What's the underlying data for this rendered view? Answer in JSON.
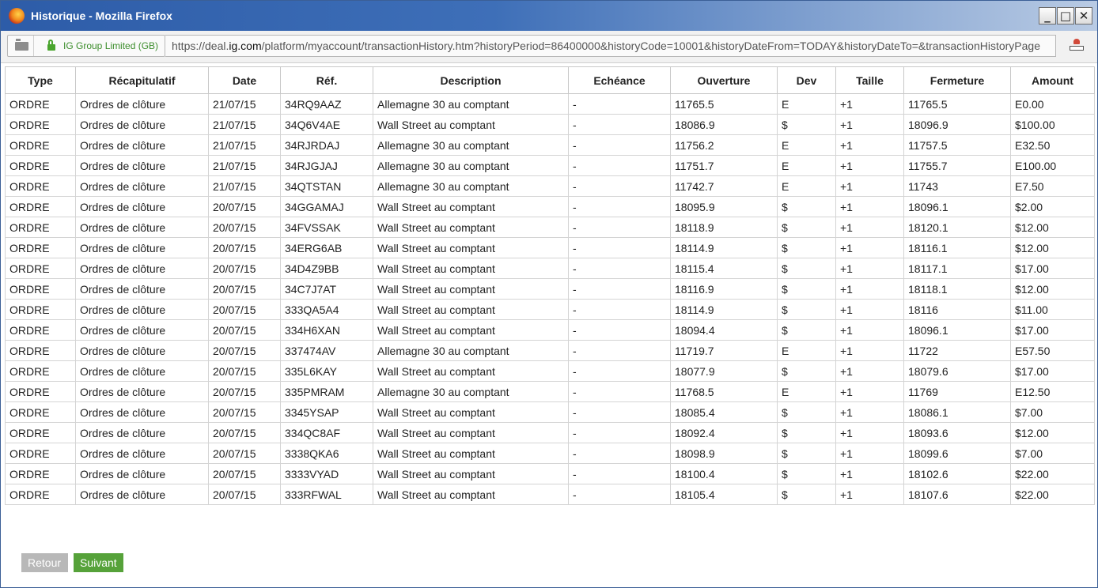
{
  "window": {
    "title": "Historique - Mozilla Firefox",
    "controls": {
      "minimize": "_",
      "maximize": "□",
      "close": "✕"
    }
  },
  "urlbar": {
    "identity": "IG Group Limited (GB)",
    "url_prefix": "https://deal.",
    "url_domain": "ig.com",
    "url_rest": "/platform/myaccount/transactionHistory.htm?historyPeriod=86400000&historyCode=10001&historyDateFrom=TODAY&historyDateTo=&transactionHistoryPage"
  },
  "table": {
    "headers": [
      "Type",
      "Récapitulatif",
      "Date",
      "Réf.",
      "Description",
      "Echéance",
      "Ouverture",
      "Dev",
      "Taille",
      "Fermeture",
      "Amount"
    ],
    "rows": [
      [
        "ORDRE",
        "Ordres de clôture",
        "21/07/15",
        "34RQ9AAZ",
        "Allemagne 30 au comptant",
        "-",
        "11765.5",
        "E",
        "+1",
        "11765.5",
        "E0.00"
      ],
      [
        "ORDRE",
        "Ordres de clôture",
        "21/07/15",
        "34Q6V4AE",
        "Wall Street au comptant",
        "-",
        "18086.9",
        "$",
        "+1",
        "18096.9",
        "$100.00"
      ],
      [
        "ORDRE",
        "Ordres de clôture",
        "21/07/15",
        "34RJRDAJ",
        "Allemagne 30 au comptant",
        "-",
        "11756.2",
        "E",
        "+1",
        "11757.5",
        "E32.50"
      ],
      [
        "ORDRE",
        "Ordres de clôture",
        "21/07/15",
        "34RJGJAJ",
        "Allemagne 30 au comptant",
        "-",
        "11751.7",
        "E",
        "+1",
        "11755.7",
        "E100.00"
      ],
      [
        "ORDRE",
        "Ordres de clôture",
        "21/07/15",
        "34QTSTAN",
        "Allemagne 30 au comptant",
        "-",
        "11742.7",
        "E",
        "+1",
        "11743",
        "E7.50"
      ],
      [
        "ORDRE",
        "Ordres de clôture",
        "20/07/15",
        "34GGAMAJ",
        "Wall Street au comptant",
        "-",
        "18095.9",
        "$",
        "+1",
        "18096.1",
        "$2.00"
      ],
      [
        "ORDRE",
        "Ordres de clôture",
        "20/07/15",
        "34FVSSAK",
        "Wall Street au comptant",
        "-",
        "18118.9",
        "$",
        "+1",
        "18120.1",
        "$12.00"
      ],
      [
        "ORDRE",
        "Ordres de clôture",
        "20/07/15",
        "34ERG6AB",
        "Wall Street au comptant",
        "-",
        "18114.9",
        "$",
        "+1",
        "18116.1",
        "$12.00"
      ],
      [
        "ORDRE",
        "Ordres de clôture",
        "20/07/15",
        "34D4Z9BB",
        "Wall Street au comptant",
        "-",
        "18115.4",
        "$",
        "+1",
        "18117.1",
        "$17.00"
      ],
      [
        "ORDRE",
        "Ordres de clôture",
        "20/07/15",
        "34C7J7AT",
        "Wall Street au comptant",
        "-",
        "18116.9",
        "$",
        "+1",
        "18118.1",
        "$12.00"
      ],
      [
        "ORDRE",
        "Ordres de clôture",
        "20/07/15",
        "333QA5A4",
        "Wall Street au comptant",
        "-",
        "18114.9",
        "$",
        "+1",
        "18116",
        "$11.00"
      ],
      [
        "ORDRE",
        "Ordres de clôture",
        "20/07/15",
        "334H6XAN",
        "Wall Street au comptant",
        "-",
        "18094.4",
        "$",
        "+1",
        "18096.1",
        "$17.00"
      ],
      [
        "ORDRE",
        "Ordres de clôture",
        "20/07/15",
        "337474AV",
        "Allemagne 30 au comptant",
        "-",
        "11719.7",
        "E",
        "+1",
        "11722",
        "E57.50"
      ],
      [
        "ORDRE",
        "Ordres de clôture",
        "20/07/15",
        "335L6KAY",
        "Wall Street au comptant",
        "-",
        "18077.9",
        "$",
        "+1",
        "18079.6",
        "$17.00"
      ],
      [
        "ORDRE",
        "Ordres de clôture",
        "20/07/15",
        "335PMRAM",
        "Allemagne 30 au comptant",
        "-",
        "11768.5",
        "E",
        "+1",
        "11769",
        "E12.50"
      ],
      [
        "ORDRE",
        "Ordres de clôture",
        "20/07/15",
        "3345YSAP",
        "Wall Street au comptant",
        "-",
        "18085.4",
        "$",
        "+1",
        "18086.1",
        "$7.00"
      ],
      [
        "ORDRE",
        "Ordres de clôture",
        "20/07/15",
        "334QC8AF",
        "Wall Street au comptant",
        "-",
        "18092.4",
        "$",
        "+1",
        "18093.6",
        "$12.00"
      ],
      [
        "ORDRE",
        "Ordres de clôture",
        "20/07/15",
        "3338QKA6",
        "Wall Street au comptant",
        "-",
        "18098.9",
        "$",
        "+1",
        "18099.6",
        "$7.00"
      ],
      [
        "ORDRE",
        "Ordres de clôture",
        "20/07/15",
        "3333VYAD",
        "Wall Street au comptant",
        "-",
        "18100.4",
        "$",
        "+1",
        "18102.6",
        "$22.00"
      ],
      [
        "ORDRE",
        "Ordres de clôture",
        "20/07/15",
        "333RFWAL",
        "Wall Street au comptant",
        "-",
        "18105.4",
        "$",
        "+1",
        "18107.6",
        "$22.00"
      ]
    ]
  },
  "buttons": {
    "back": "Retour",
    "next": "Suivant"
  }
}
